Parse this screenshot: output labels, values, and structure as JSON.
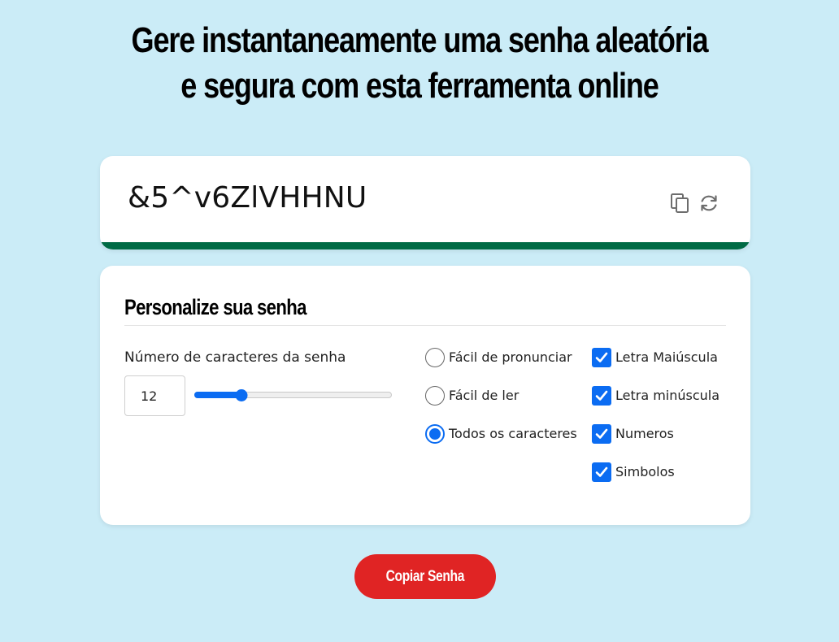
{
  "page": {
    "title_line1": "Gere instantaneamente uma senha aleatória",
    "title_line2": "e segura com esta ferramenta online"
  },
  "password": {
    "value": "&5^v6ZlVHHNU",
    "strength_color": "#006b45",
    "copy_icon": "copy-icon",
    "refresh_icon": "refresh-icon"
  },
  "options": {
    "title": "Personalize sua senha",
    "length_label": "Número de caracteres da senha",
    "length_value": "12",
    "slider_fraction": 0.24,
    "radios": [
      {
        "label": "Fácil de pronunciar",
        "checked": false
      },
      {
        "label": "Fácil de ler",
        "checked": false
      },
      {
        "label": "Todos os caracteres",
        "checked": true
      }
    ],
    "checkboxes": [
      {
        "label": "Letra Maiúscula",
        "checked": true
      },
      {
        "label": "Letra minúscula",
        "checked": true
      },
      {
        "label": "Numeros",
        "checked": true
      },
      {
        "label": "Simbolos",
        "checked": true
      }
    ]
  },
  "actions": {
    "copy_label": "Copiar Senha"
  },
  "colors": {
    "background": "#cbecf7",
    "accent": "#0b6cf2",
    "button": "#e02424"
  }
}
